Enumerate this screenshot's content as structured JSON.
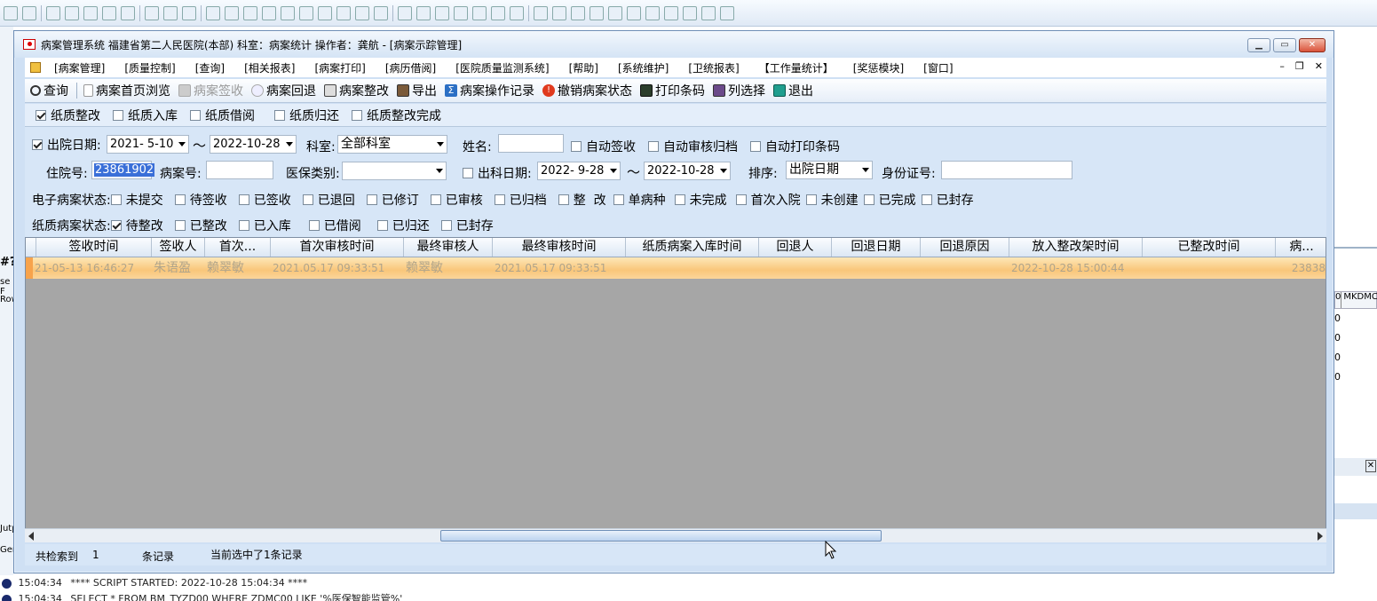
{
  "window": {
    "title": "病案管理系统  福建省第二人民医院(本部)  科室：病案统计 操作者：龚航 - [病案示踪管理]"
  },
  "menu": [
    "[病案管理]",
    "[质量控制]",
    "[查询]",
    "[相关报表]",
    "[病案打印]",
    "[病历借阅]",
    "[医院质量监测系统]",
    "[帮助]",
    "[系统维护]",
    "[卫统报表]",
    "【工作量统计】",
    "[奖惩模块]",
    "[窗口]"
  ],
  "toolbar": [
    {
      "label": "查询",
      "icon": "magnifier-icon",
      "enabled": true
    },
    {
      "label": "病案首页浏览",
      "icon": "document-icon",
      "enabled": true
    },
    {
      "label": "病案签收",
      "icon": "check-icon",
      "enabled": false
    },
    {
      "label": "病案回退",
      "icon": "return-icon",
      "enabled": true
    },
    {
      "label": "病案整改",
      "icon": "edit-icon",
      "enabled": true
    },
    {
      "label": "导出",
      "icon": "export-icon",
      "enabled": true
    },
    {
      "label": "病案操作记录",
      "icon": "sigma-icon",
      "enabled": true
    },
    {
      "label": "撤销病案状态",
      "icon": "alert-icon",
      "enabled": true
    },
    {
      "label": "打印条码",
      "icon": "printer-icon",
      "enabled": true
    },
    {
      "label": "列选择",
      "icon": "columns-icon",
      "enabled": true
    },
    {
      "label": "退出",
      "icon": "exit-icon",
      "enabled": true
    }
  ],
  "tabs": [
    {
      "label": "纸质整改",
      "checked": true
    },
    {
      "label": "纸质入库",
      "checked": false
    },
    {
      "label": "纸质借阅",
      "checked": false
    },
    {
      "label": "纸质归还",
      "checked": false
    },
    {
      "label": "纸质整改完成",
      "checked": false
    }
  ],
  "filters": {
    "discharge_date_label": "出院日期:",
    "discharge_date_checked": true,
    "date_from": "2021- 5-10",
    "tilde": "～",
    "date_to": "2022-10-28",
    "dept_label": "科室:",
    "dept_value": "全部科室",
    "name_label": "姓名:",
    "name_value": "",
    "auto_sign": "自动签收",
    "auto_archive": "自动审核归档",
    "auto_print": "自动打印条码",
    "inpatient_no_label": "住院号:",
    "inpatient_no_value": "23861902",
    "record_no_label": "病案号:",
    "record_no_value": "",
    "insurance_label": "医保类别:",
    "insurance_value": "",
    "dept_out_label": "出科日期:",
    "dept_out_from": "2022- 9-28",
    "dept_out_to": "2022-10-28",
    "sort_label": "排序:",
    "sort_value": "出院日期",
    "id_label": "身份证号:",
    "id_value": "",
    "e_status_label": "电子病案状态:",
    "e_status": [
      {
        "label": "未提交",
        "checked": false
      },
      {
        "label": "待签收",
        "checked": false
      },
      {
        "label": "已签收",
        "checked": false
      },
      {
        "label": "已退回",
        "checked": false
      },
      {
        "label": "已修订",
        "checked": false
      },
      {
        "label": "已审核",
        "checked": false
      },
      {
        "label": "已归档",
        "checked": false
      },
      {
        "label": "整  改",
        "checked": false
      },
      {
        "label": "单病种",
        "checked": false
      },
      {
        "label": "未完成",
        "checked": false
      },
      {
        "label": "首次入院",
        "checked": false
      },
      {
        "label": "未创建",
        "checked": false
      },
      {
        "label": "已完成",
        "checked": false
      },
      {
        "label": "已封存",
        "checked": false
      }
    ],
    "p_status_label": "纸质病案状态:",
    "p_status": [
      {
        "label": "待整改",
        "checked": true
      },
      {
        "label": "已整改",
        "checked": false
      },
      {
        "label": "已入库",
        "checked": false
      },
      {
        "label": "已借阅",
        "checked": false
      },
      {
        "label": "已归还",
        "checked": false
      },
      {
        "label": "已封存",
        "checked": false
      }
    ]
  },
  "grid": {
    "columns": [
      "签收时间",
      "签收人",
      "首次...",
      "首次审核时间",
      "最终审核人",
      "最终审核时间",
      "纸质病案入库时间",
      "回退人",
      "回退日期",
      "回退原因",
      "放入整改架时间",
      "已整改时间",
      "病..."
    ],
    "rows": [
      [
        "21-05-13 16:46:27",
        "朱语盈",
        "赖翠敏",
        "2021.05.17 09:33:51",
        "赖翠敏",
        "2021.05.17 09:33:51",
        "",
        "",
        "",
        "",
        "2022-10-28 15:00:44",
        "",
        "23838"
      ]
    ]
  },
  "status": {
    "found_label": "共检索到",
    "count": "1",
    "unit": "条记录",
    "selected": "当前选中了1条记录"
  },
  "log": {
    "line1_time": "15:04:34",
    "line1_text": "**** SCRIPT STARTED: 2022-10-28 15:04:34 ****",
    "line2_time": "15:04:34",
    "line2_text": "SELECT * FROM BM_TYZD00 WHERE ZDMC00 LIKE '%医保智能监管%'"
  },
  "background": {
    "left_labels": [
      "#?",
      "se F",
      "Row",
      "Jutp",
      "Gen"
    ],
    "right_header": [
      "0",
      "MKDMC"
    ],
    "right_vals": [
      "0",
      "0",
      "0",
      "0"
    ]
  }
}
